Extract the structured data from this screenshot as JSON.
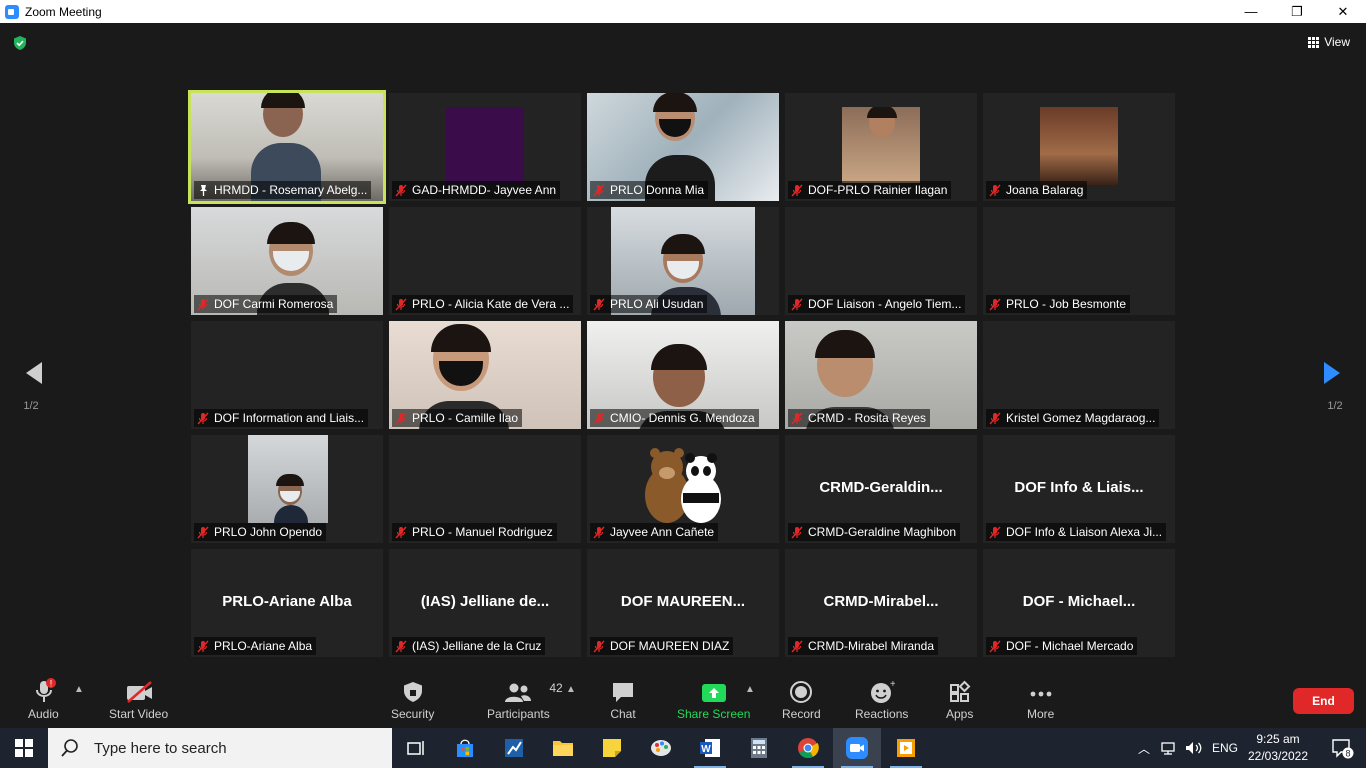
{
  "window": {
    "title": "Zoom Meeting",
    "minimize": "—",
    "restore": "❐",
    "close": "✕"
  },
  "header": {
    "view_label": "View"
  },
  "pager": {
    "left": "1/2",
    "right": "1/2"
  },
  "participants": [
    {
      "name": "HRMDD - Rosemary Abelg...",
      "video": true,
      "pinned": true,
      "big": ""
    },
    {
      "name": "GAD-HRMDD- Jayvee Ann",
      "video": true,
      "big": ""
    },
    {
      "name": "PRLO Donna Mia",
      "video": true,
      "big": ""
    },
    {
      "name": "DOF-PRLO Rainier Ilagan",
      "video": true,
      "big": ""
    },
    {
      "name": "Joana Balarag",
      "video": true,
      "big": ""
    },
    {
      "name": "DOF Carmi Romerosa",
      "video": true,
      "big": ""
    },
    {
      "name": "PRLO - Alicia Kate de Vera ...",
      "video": false,
      "big": ""
    },
    {
      "name": "PRLO Ali Usudan",
      "video": true,
      "big": ""
    },
    {
      "name": "DOF Liaison - Angelo Tiem...",
      "video": false,
      "big": ""
    },
    {
      "name": "PRLO - Job Besmonte",
      "video": false,
      "big": ""
    },
    {
      "name": "DOF Information and Liais...",
      "video": false,
      "big": ""
    },
    {
      "name": "PRLO - Camille Ilao",
      "video": true,
      "big": ""
    },
    {
      "name": "CMIO- Dennis G. Mendoza",
      "video": true,
      "big": ""
    },
    {
      "name": "CRMD - Rosita Reyes",
      "video": true,
      "big": ""
    },
    {
      "name": "Kristel Gomez Magdaraog...",
      "video": false,
      "big": ""
    },
    {
      "name": "PRLO John Opendo",
      "video": true,
      "big": ""
    },
    {
      "name": "PRLO - Manuel Rodriguez",
      "video": false,
      "big": ""
    },
    {
      "name": "Jayvee Ann Cañete",
      "video": true,
      "big": ""
    },
    {
      "name": "CRMD-Geraldine Maghibon",
      "video": false,
      "big": "CRMD-Geraldin..."
    },
    {
      "name": "DOF Info & Liaison Alexa Ji...",
      "video": false,
      "big": "DOF Info & Liais..."
    },
    {
      "name": "PRLO-Ariane Alba",
      "video": false,
      "big": "PRLO-Ariane Alba"
    },
    {
      "name": "(IAS) Jelliane de la Cruz",
      "video": false,
      "big": "(IAS) Jelliane de..."
    },
    {
      "name": "DOF MAUREEN DIAZ",
      "video": false,
      "big": "DOF  MAUREEN..."
    },
    {
      "name": "CRMD-Mirabel Miranda",
      "video": false,
      "big": "CRMD-Mirabel..."
    },
    {
      "name": "DOF - Michael Mercado",
      "video": false,
      "big": "DOF  -  Michael..."
    }
  ],
  "toolbar": {
    "audio": "Audio",
    "audio_badge": "!",
    "start_video": "Start Video",
    "security": "Security",
    "participants": "Participants",
    "participants_count": "42",
    "chat": "Chat",
    "share_screen": "Share Screen",
    "record": "Record",
    "reactions": "Reactions",
    "apps": "Apps",
    "more": "More",
    "end": "End"
  },
  "taskbar": {
    "search_placeholder": "Type here to search",
    "language": "ENG",
    "time": "9:25 am",
    "date": "22/03/2022",
    "notification_count": "8"
  },
  "colors": {
    "active_speaker": "#c8e35a",
    "end_button": "#e02828",
    "share_green": "#23d959",
    "accent_blue": "#2d8cff"
  }
}
